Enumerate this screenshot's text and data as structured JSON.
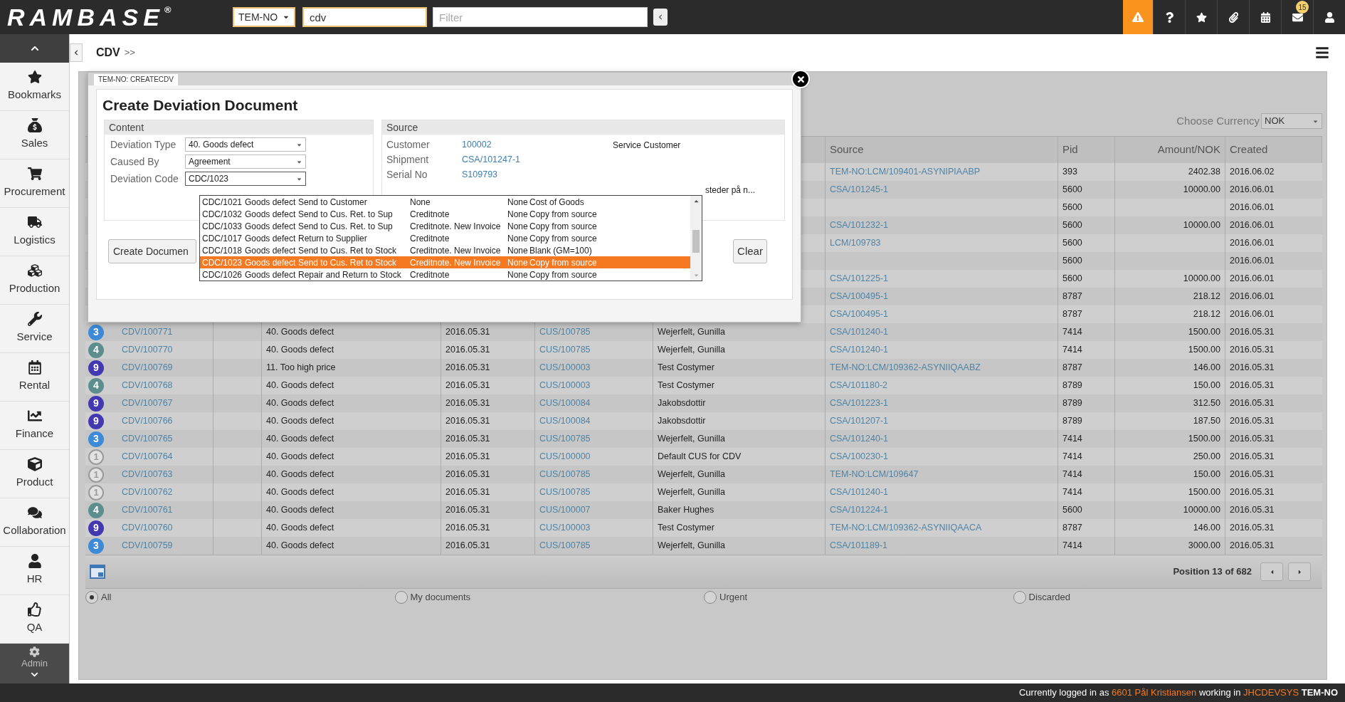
{
  "top_bar": {
    "logo": "RAMBASE",
    "logo_mark": "®",
    "company": "TEM-NO",
    "search_value": "cdv",
    "filter_placeholder": "Filter",
    "notification_badge": "15"
  },
  "sidebar": {
    "items": [
      {
        "label": "Bookmarks"
      },
      {
        "label": "Sales"
      },
      {
        "label": "Procurement"
      },
      {
        "label": "Logistics"
      },
      {
        "label": "Production"
      },
      {
        "label": "Service"
      },
      {
        "label": "Rental"
      },
      {
        "label": "Finance"
      },
      {
        "label": "Product"
      },
      {
        "label": "Collaboration"
      },
      {
        "label": "HR"
      },
      {
        "label": "QA"
      },
      {
        "label": "Admin"
      }
    ]
  },
  "breadcrumb": {
    "title": "CDV",
    "separator": ">>"
  },
  "currency": {
    "label": "Choose Currency",
    "value": "NOK"
  },
  "table": {
    "columns": [
      "Source",
      "Pid",
      "Amount/NOK",
      "Created"
    ],
    "rows": [
      {
        "source": "TEM-NO:LCM/109401-ASYNIPIAABP",
        "pid": "393",
        "amount": "2402.38",
        "created": "2016.06.02"
      },
      {
        "source": "CSA/101245-1",
        "pid": "5600",
        "amount": "10000.00",
        "created": "2016.06.01"
      },
      {
        "pid": "5600",
        "created": "2016.06.01"
      },
      {
        "source": "CSA/101232-1",
        "pid": "5600",
        "amount": "10000.00",
        "created": "2016.06.01"
      },
      {
        "source": "LCM/109783",
        "pid": "5600",
        "created": "2016.06.01"
      },
      {
        "pid": "5600",
        "created": "2016.06.01"
      },
      {
        "source": "CSA/101225-1",
        "pid": "5600",
        "amount": "10000.00",
        "created": "2016.06.01"
      },
      {
        "source": "CSA/100495-1",
        "pid": "8787",
        "amount": "218.12",
        "created": "2016.06.01"
      },
      {
        "source": "CSA/100495-1",
        "pid": "8787",
        "amount": "218.12",
        "created": "2016.06.01"
      },
      {
        "status": "3",
        "kind": "filled",
        "color": "#3d8ad8",
        "number": "CDV/100771",
        "type": "40. Goods defect",
        "date": "2016.05.31",
        "customer": "CUS/100785",
        "name": "Wejerfelt, Gunilla",
        "source": "CSA/101240-1",
        "pid": "7414",
        "amount": "1500.00",
        "created": "2016.05.31"
      },
      {
        "status": "4",
        "kind": "filled",
        "color": "#5d8e8e",
        "number": "CDV/100770",
        "type": "40. Goods defect",
        "date": "2016.05.31",
        "customer": "CUS/100785",
        "name": "Wejerfelt, Gunilla",
        "source": "CSA/101240-1",
        "pid": "7414",
        "amount": "1500.00",
        "created": "2016.05.31"
      },
      {
        "status": "9",
        "kind": "filled",
        "color": "#4338b0",
        "number": "CDV/100769",
        "type": "11. Too high price",
        "date": "2016.05.31",
        "customer": "CUS/100003",
        "name": "Test Costymer",
        "source": "TEM-NO:LCM/109362-ASYNIIQAABZ",
        "pid": "8787",
        "amount": "146.00",
        "created": "2016.05.31"
      },
      {
        "status": "4",
        "kind": "filled",
        "color": "#5d8e8e",
        "number": "CDV/100768",
        "type": "40. Goods defect",
        "date": "2016.05.31",
        "customer": "CUS/100003",
        "name": "Test Costymer",
        "source": "CSA/101180-2",
        "pid": "8789",
        "amount": "150.00",
        "created": "2016.05.31"
      },
      {
        "status": "9",
        "kind": "filled",
        "color": "#4338b0",
        "number": "CDV/100767",
        "type": "40. Goods defect",
        "date": "2016.05.31",
        "customer": "CUS/100084",
        "name": "Jakobsdottir",
        "source": "CSA/101223-1",
        "pid": "8789",
        "amount": "312.50",
        "created": "2016.05.31"
      },
      {
        "status": "9",
        "kind": "filled",
        "color": "#4338b0",
        "number": "CDV/100766",
        "type": "40. Goods defect",
        "date": "2016.05.31",
        "customer": "CUS/100084",
        "name": "Jakobsdottir",
        "source": "CSA/101207-1",
        "pid": "8789",
        "amount": "187.50",
        "created": "2016.05.31"
      },
      {
        "status": "3",
        "kind": "filled",
        "color": "#3d8ad8",
        "number": "CDV/100765",
        "type": "40. Goods defect",
        "date": "2016.05.31",
        "customer": "CUS/100785",
        "name": "Wejerfelt, Gunilla",
        "source": "CSA/101240-1",
        "pid": "7414",
        "amount": "1500.00",
        "created": "2016.05.31"
      },
      {
        "status": "1",
        "kind": "outline",
        "color": "#9a9a9a",
        "number": "CDV/100764",
        "type": "40. Goods defect",
        "date": "2016.05.31",
        "customer": "CUS/100000",
        "name": "Default CUS for CDV",
        "source": "CSA/100230-1",
        "pid": "7414",
        "amount": "250.00",
        "created": "2016.05.31"
      },
      {
        "status": "1",
        "kind": "outline",
        "color": "#9a9a9a",
        "number": "CDV/100763",
        "type": "40. Goods defect",
        "date": "2016.05.31",
        "customer": "CUS/100785",
        "name": "Wejerfelt, Gunilla",
        "source": "TEM-NO:LCM/109647",
        "pid": "7414",
        "amount": "150.00",
        "created": "2016.05.31"
      },
      {
        "status": "1",
        "kind": "outline",
        "color": "#9a9a9a",
        "number": "CDV/100762",
        "type": "40. Goods defect",
        "date": "2016.05.31",
        "customer": "CUS/100785",
        "name": "Wejerfelt, Gunilla",
        "source": "CSA/101240-1",
        "pid": "7414",
        "amount": "1500.00",
        "created": "2016.05.31"
      },
      {
        "status": "4",
        "kind": "filled",
        "color": "#5d8e8e",
        "number": "CDV/100761",
        "type": "40. Goods defect",
        "date": "2016.05.31",
        "customer": "CUS/100007",
        "name": "Baker Hughes",
        "source": "CSA/101224-1",
        "pid": "5600",
        "amount": "10000.00",
        "created": "2016.05.31"
      },
      {
        "status": "9",
        "kind": "filled",
        "color": "#4338b0",
        "number": "CDV/100760",
        "type": "40. Goods defect",
        "date": "2016.05.31",
        "customer": "CUS/100003",
        "name": "Test Costymer",
        "source": "TEM-NO:LCM/109362-ASYNIIQAACA",
        "pid": "8787",
        "amount": "146.00",
        "created": "2016.05.31"
      },
      {
        "status": "3",
        "kind": "filled",
        "color": "#3d8ad8",
        "number": "CDV/100759",
        "type": "40. Goods defect",
        "date": "2016.05.31",
        "customer": "CUS/100785",
        "name": "Wejerfelt, Gunilla",
        "source": "CSA/101189-1",
        "pid": "7414",
        "amount": "3000.00",
        "created": "2016.05.31"
      }
    ],
    "position": "Position 13 of 682"
  },
  "filters": [
    {
      "label": "All",
      "selected": true
    },
    {
      "label": "My documents",
      "selected": false
    },
    {
      "label": "Urgent",
      "selected": false
    },
    {
      "label": "Discarded",
      "selected": false
    }
  ],
  "dialog": {
    "tab": "TEM-NO: CREATECDV",
    "title": "Create Deviation Document",
    "content": {
      "heading": "Content",
      "fields": [
        {
          "label": "Deviation Type",
          "value": "40. Goods defect",
          "focused": false
        },
        {
          "label": "Caused By",
          "value": "Agreement",
          "focused": false
        },
        {
          "label": "Deviation Code",
          "value": "CDC/1023",
          "focused": true
        }
      ]
    },
    "source": {
      "heading": "Source",
      "fields": [
        {
          "label": "Customer",
          "value": "100002",
          "note": "Service Customer"
        },
        {
          "label": "Shipment",
          "value": "CSA/101247-1"
        },
        {
          "label": "Serial No",
          "value": "S109793"
        }
      ],
      "overflow_note": "steder på n..."
    },
    "dropdown": {
      "options": [
        {
          "code": "CDC/1021",
          "group": "Goods defect",
          "action": "Send to Customer",
          "credit": "None",
          "none": "None",
          "copy": "Cost of Goods",
          "selected": false
        },
        {
          "code": "CDC/1032",
          "group": "Goods defect",
          "action": "Send to Cus. Ret. to Sup",
          "credit": "Creditnote",
          "none": "None",
          "copy": "Copy from source",
          "selected": false
        },
        {
          "code": "CDC/1033",
          "group": "Goods defect",
          "action": "Send to Cus. Ret. to Sup",
          "credit": "Creditnote. New Invoice",
          "none": "None",
          "copy": "Copy from source",
          "selected": false
        },
        {
          "code": "CDC/1017",
          "group": "Goods defect",
          "action": "Return to Supplier",
          "credit": "Creditnote",
          "none": "None",
          "copy": "Copy from source",
          "selected": false
        },
        {
          "code": "CDC/1018",
          "group": "Goods defect",
          "action": "Send to Cus. Ret to Stock",
          "credit": "Creditnote. New Invoice",
          "none": "None",
          "copy": "Blank (GM=100)",
          "selected": false
        },
        {
          "code": "CDC/1023",
          "group": "Goods defect",
          "action": "Send to Cus. Ret to Stock",
          "credit": "Creditnote. New Invoice",
          "none": "None",
          "copy": "Copy from source",
          "selected": true
        },
        {
          "code": "CDC/1026",
          "group": "Goods defect",
          "action": "Repair and Return to Stock",
          "credit": "Creditnote",
          "none": "None",
          "copy": "Copy from source",
          "selected": false
        }
      ]
    },
    "buttons": {
      "create": "Create Documen",
      "clear": "Clear"
    }
  },
  "status_bar": {
    "prefix": "Currently logged in as",
    "user": "6601 Pål Kristiansen",
    "middle": "working in",
    "system": "JHCDEVSYS",
    "company": "TEM-NO"
  }
}
